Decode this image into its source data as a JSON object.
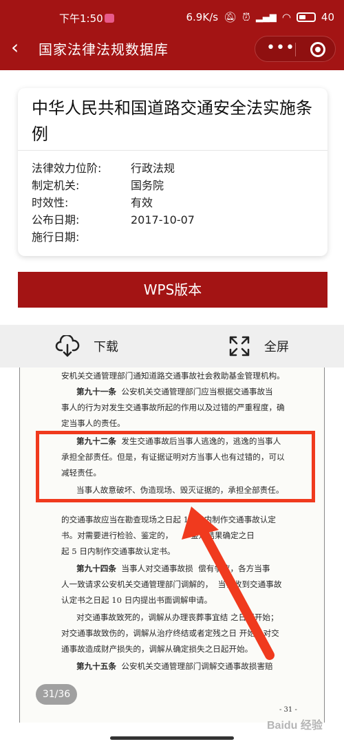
{
  "status": {
    "time": "下午1:50",
    "speed": "6.9K/s",
    "battery": "40"
  },
  "nav": {
    "title": "国家法律法规数据库",
    "more": "•••"
  },
  "law": {
    "title": "中华人民共和国道路交通安全法实施条例",
    "fields": [
      {
        "key": "法律效力位阶:",
        "value": "行政法规"
      },
      {
        "key": "制定机关:",
        "value": "国务院"
      },
      {
        "key": "时效性:",
        "value": "有效"
      },
      {
        "key": "公布日期:",
        "value": "2017-10-07"
      },
      {
        "key": "施行日期:",
        "value": ""
      }
    ]
  },
  "wps_label": "WPS版本",
  "toolbar": {
    "download": "下载",
    "fullscreen": "全屏"
  },
  "doc": {
    "lines": [
      "安机关交通管理部门通知道路交通事故社会救助基金管理机构。",
      "第九十一条",
      "公安机关交通管理部门应当根据交通事故当",
      "事人的行为对发生交通事故所起的作用以及过错的严重程度，确",
      "定当事人的责任。",
      "第九十二条",
      "发生交通事故后当事人逃逸的，逃逸的当事人",
      "承担全部责任。但是，有证据证明对方当事人也有过错的，可以",
      "减轻责任。",
      "当事人故意破坏、伪造现场、毁灭证据的，承担全部责任。",
      "的交通事故应当在勘查现场之日起",
      "10",
      "日内制作交通事故认定",
      "书。对需要进行检验、鉴定的，",
      "鉴定结果确定之日",
      "起",
      "5",
      "日内制作交通事故认定书。",
      "第九十四条",
      "当事人对交通事故损",
      "偿有争议，各方当事",
      "人一致请求公安机关交通管理部门调解的，",
      "当在收到交通事故",
      "认定书之日起",
      "10",
      "日内提出书面调解申请。",
      "对交通事故致死的，调解从办理丧葬事宜结",
      "之日起开始；",
      "对交通事故致伤的，调解从治疗终结或者定残之日",
      "开始；对交",
      "通事故造成财产损失的，调解从确定损失之日起开始。",
      "第九十五条",
      "公安机关交通管理部门调解交通事故损害赔"
    ],
    "page_label": "- 31 -"
  },
  "page_indicator": "31/36",
  "watermark": "Baidu 经验",
  "colors": {
    "brand_red": "#a31414",
    "highlight": "#f03a1e"
  }
}
